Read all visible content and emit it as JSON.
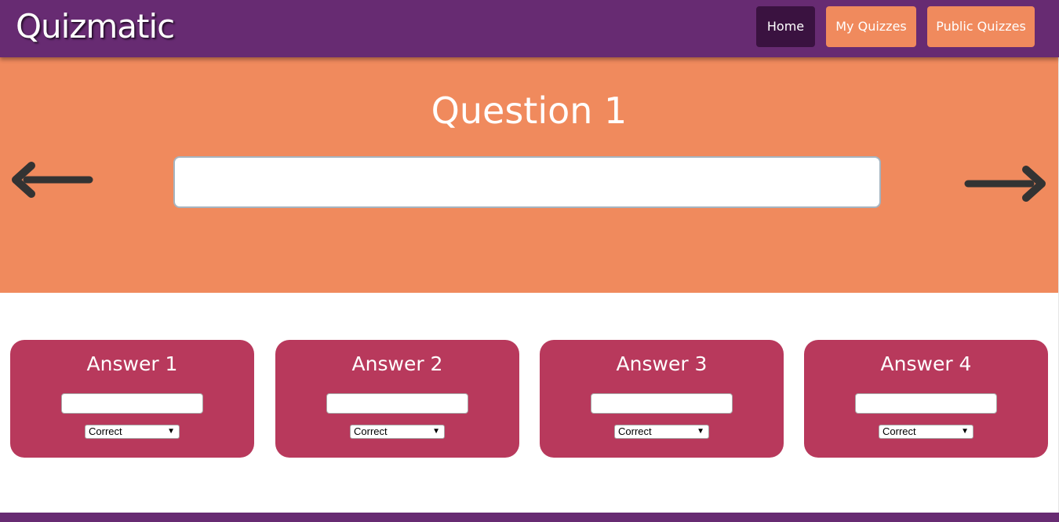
{
  "app": {
    "logo": "Quizmatic"
  },
  "nav": {
    "items": [
      {
        "label": "Home",
        "active": true
      },
      {
        "label": "My Quizzes",
        "active": false
      },
      {
        "label": "Public Quizzes",
        "active": false
      }
    ]
  },
  "question": {
    "title": "Question 1",
    "value": "",
    "prev_icon": "arrow-left-icon",
    "next_icon": "arrow-right-icon"
  },
  "answers": [
    {
      "title": "Answer 1",
      "value": "",
      "selected": "Correct"
    },
    {
      "title": "Answer 2",
      "value": "",
      "selected": "Correct"
    },
    {
      "title": "Answer 3",
      "value": "",
      "selected": "Correct"
    },
    {
      "title": "Answer 4",
      "value": "",
      "selected": "Correct"
    }
  ],
  "colors": {
    "navbar": "#672b72",
    "nav_active": "#3a1240",
    "accent_orange": "#f08a5d",
    "answer_card": "#b8395c"
  }
}
